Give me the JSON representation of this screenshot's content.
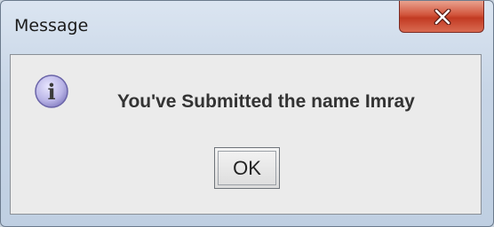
{
  "window": {
    "title": "Message",
    "close_icon": "close-icon"
  },
  "dialog": {
    "icon": "info-icon",
    "icon_glyph": "i",
    "message": "You've Submitted the name Imray",
    "ok_label": "OK"
  },
  "colors": {
    "close_button": "#d2553c",
    "info_icon": "#b9b4e6"
  }
}
